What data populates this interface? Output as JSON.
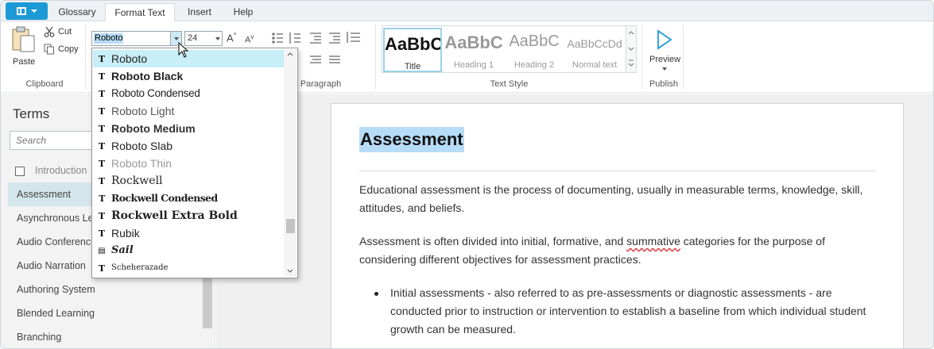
{
  "tabs": [
    {
      "label": "Glossary",
      "active": false
    },
    {
      "label": "Format Text",
      "active": true
    },
    {
      "label": "Insert",
      "active": false
    },
    {
      "label": "Help",
      "active": false
    }
  ],
  "clipboard": {
    "paste": "Paste",
    "cut": "Cut",
    "copy": "Copy",
    "group_label": "Clipboard"
  },
  "font": {
    "name_value": "Roboto",
    "size_value": "24"
  },
  "paragraph": {
    "group_label": "Paragraph"
  },
  "text_style": {
    "group_label": "Text Style",
    "items": [
      {
        "preview": "AaBbC",
        "caption": "Title"
      },
      {
        "preview": "AaBbC",
        "caption": "Heading 1"
      },
      {
        "preview": "AaBbC",
        "caption": "Heading 2"
      },
      {
        "preview": "AaBbCcDd",
        "caption": "Normal text"
      }
    ]
  },
  "publish": {
    "preview": "Preview",
    "group_label": "Publish"
  },
  "terms": {
    "title": "Terms",
    "search_placeholder": "Search",
    "items": [
      {
        "label": "Introduction"
      },
      {
        "label": "Assessment"
      },
      {
        "label": "Asynchronous Learning"
      },
      {
        "label": "Audio Conferencing"
      },
      {
        "label": "Audio Narration"
      },
      {
        "label": "Authoring System"
      },
      {
        "label": "Blended Learning"
      },
      {
        "label": "Branching"
      }
    ]
  },
  "font_list": [
    {
      "name": "Roboto"
    },
    {
      "name": "Roboto Black"
    },
    {
      "name": "Roboto Condensed"
    },
    {
      "name": "Roboto Light"
    },
    {
      "name": "Roboto Medium"
    },
    {
      "name": "Roboto Slab"
    },
    {
      "name": "Roboto Thin"
    },
    {
      "name": "Rockwell"
    },
    {
      "name": "Rockwell Condensed"
    },
    {
      "name": "Rockwell Extra Bold"
    },
    {
      "name": "Rubik"
    },
    {
      "name": "Sail"
    },
    {
      "name": "Scheherazade"
    }
  ],
  "document": {
    "title": "Assessment",
    "p1": "Educational assessment is the process of documenting, usually in measurable terms, knowledge, skill, attitudes, and beliefs.",
    "p2_before": "Assessment is often divided into initial, formative, and ",
    "p2_misspelled": "summative",
    "p2_after": " categories for the purpose of considering different objectives for assessment practices.",
    "bullet1": "Initial assessments - also referred to as pre-assessments or diagnostic assessments - are conducted prior to instruction or intervention to establish a baseline from which individual student growth can be measured."
  },
  "colors": {
    "accent": "#1d9ad6",
    "selection": "#b7dcf7",
    "active_term": "#d3e6ec",
    "dropdown_highlight": "#c8eef7"
  }
}
